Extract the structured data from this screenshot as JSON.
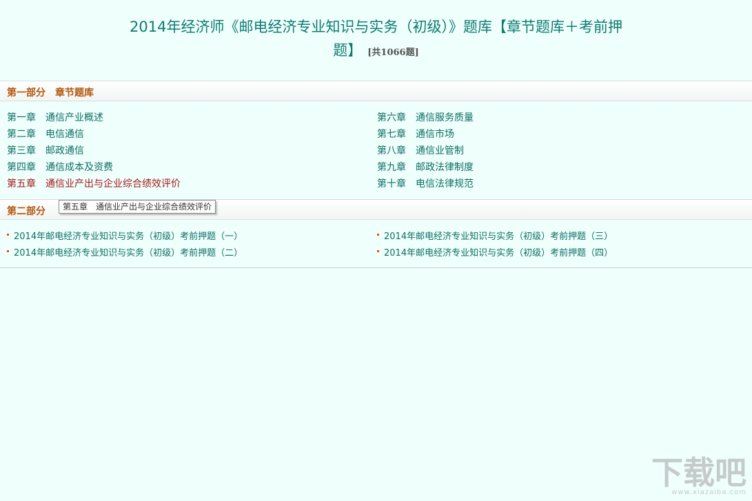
{
  "title": {
    "line1": "2014年经济师《邮电经济专业知识与实务（初级）》题库【章节题库＋考前押",
    "line2": "题】",
    "count": "[共1066题]"
  },
  "section1": {
    "part": "第一部分",
    "name": "章节题库",
    "chapters": [
      {
        "num": "第一章",
        "name": "通信产业概述"
      },
      {
        "num": "第二章",
        "name": "电信通信"
      },
      {
        "num": "第三章",
        "name": "邮政通信"
      },
      {
        "num": "第四章",
        "name": "通信成本及资费"
      },
      {
        "num": "第五章",
        "name": "通信业产出与企业综合绩效评价"
      },
      {
        "num": "第六章",
        "name": "通信服务质量"
      },
      {
        "num": "第七章",
        "name": "通信市场"
      },
      {
        "num": "第八章",
        "name": "通信业管制"
      },
      {
        "num": "第九章",
        "name": "邮政法律制度"
      },
      {
        "num": "第十章",
        "name": "电信法律规范"
      }
    ]
  },
  "section2": {
    "part": "第二部分",
    "exams": [
      "2014年邮电经济专业知识与实务（初级）考前押题（一）",
      "2014年邮电经济专业知识与实务（初级）考前押题（二）",
      "2014年邮电经济专业知识与实务（初级）考前押题（三）",
      "2014年邮电经济专业知识与实务（初级）考前押题（四）"
    ]
  },
  "tooltip": "第五章　通信业产出与企业综合绩效评价",
  "watermark": {
    "logo": "下载吧",
    "url": "www.xiazaiba.com"
  }
}
